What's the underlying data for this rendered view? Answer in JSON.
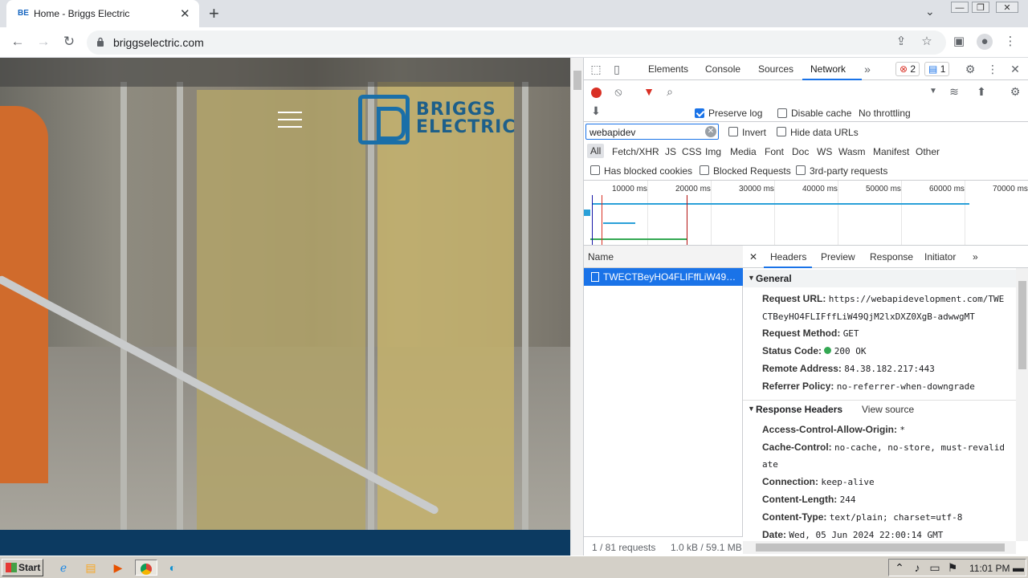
{
  "browser": {
    "tab_title": "Home - Briggs Electric",
    "tab_favicon": "BE",
    "address": "briggselectric.com"
  },
  "site": {
    "logo_line1": "BRIGGS",
    "logo_line2": "ELECTRIC",
    "brand_color": "#1a6fa8"
  },
  "devtools": {
    "tabs": [
      "Elements",
      "Console",
      "Sources",
      "Network"
    ],
    "active_tab": "Network",
    "error_count": "2",
    "message_count": "1",
    "preserve_log_label": "Preserve log",
    "disable_cache_label": "Disable cache",
    "throttling": "No throttling",
    "filter_value": "webapidev",
    "invert_label": "Invert",
    "hide_data_urls_label": "Hide data URLs",
    "filter_types": [
      "All",
      "Fetch/XHR",
      "JS",
      "CSS",
      "Img",
      "Media",
      "Font",
      "Doc",
      "WS",
      "Wasm",
      "Manifest",
      "Other"
    ],
    "blocked_cookies_label": "Has blocked cookies",
    "blocked_requests_label": "Blocked Requests",
    "third_party_label": "3rd-party requests",
    "timeline_ticks": [
      "10000 ms",
      "20000 ms",
      "30000 ms",
      "40000 ms",
      "50000 ms",
      "60000 ms",
      "70000 ms"
    ],
    "name_column": "Name",
    "request_name": "TWECTBeyHO4FLIFffLiW49Q...",
    "status_requests": "1 / 81 requests",
    "status_transfer": "1.0 kB / 59.1 MB",
    "detail_tabs": [
      "Headers",
      "Preview",
      "Response",
      "Initiator"
    ],
    "general_title": "General",
    "request_url_label": "Request URL:",
    "request_url_line1": "https://webapidevelopment.com/TWE",
    "request_url_line2": "CTBeyHO4FLIFffLiW49QjM2lxDXZ0XgB-adwwgMT",
    "request_method_label": "Request Method:",
    "request_method": "GET",
    "status_code_label": "Status Code:",
    "status_code": "200 OK",
    "remote_address_label": "Remote Address:",
    "remote_address": "84.38.182.217:443",
    "referrer_policy_label": "Referrer Policy:",
    "referrer_policy": "no-referrer-when-downgrade",
    "response_headers_title": "Response Headers",
    "view_source": "View source",
    "acao_label": "Access-Control-Allow-Origin:",
    "acao": "*",
    "cache_control_label": "Cache-Control:",
    "cache_control_line1": "no-cache, no-store, must-revalid",
    "cache_control_line2": "ate",
    "connection_label": "Connection:",
    "connection": "keep-alive",
    "content_length_label": "Content-Length:",
    "content_length": "244",
    "content_type_label": "Content-Type:",
    "content_type": "text/plain; charset=utf-8",
    "date_label": "Date:",
    "date": "Wed, 05 Jun 2024 22:00:14 GMT"
  },
  "taskbar": {
    "start_label": "Start",
    "clock": "11:01 PM"
  }
}
